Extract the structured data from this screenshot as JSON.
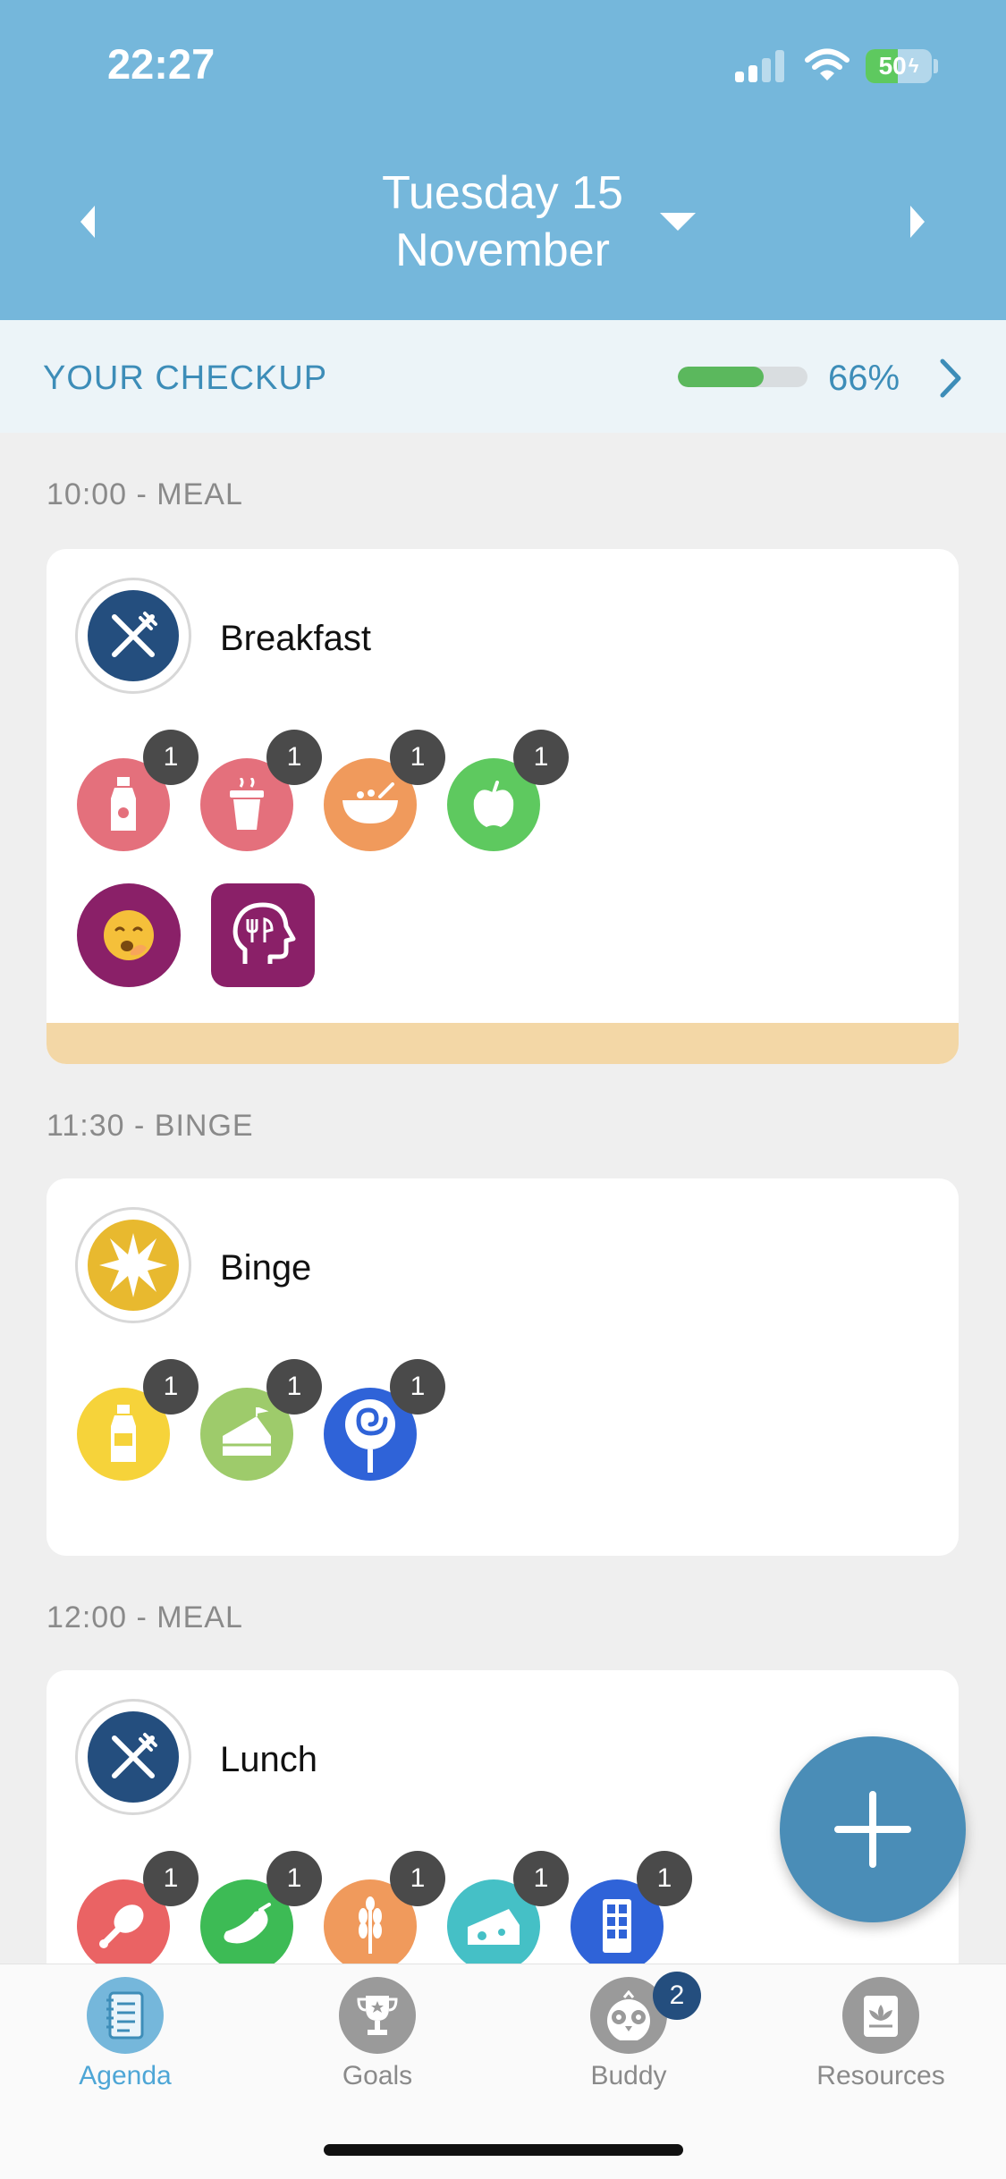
{
  "status_bar": {
    "time": "22:27",
    "battery": "50"
  },
  "header": {
    "date_line1": "Tuesday 15",
    "date_line2": "November"
  },
  "checkup": {
    "title": "YOUR CHECKUP",
    "progress": 0.66,
    "percent_label": "66%"
  },
  "entries": [
    {
      "label": "10:00 - MEAL",
      "title": "Breakfast",
      "avatar_icon": "fork-knife-icon",
      "avatar_color": "#244e7e",
      "items": [
        {
          "icon": "bottle-icon",
          "color": "#e4707c",
          "count": "1"
        },
        {
          "icon": "cup-icon",
          "color": "#e4707c",
          "count": "1"
        },
        {
          "icon": "bowl-icon",
          "color": "#f09a5c",
          "count": "1"
        },
        {
          "icon": "apple-icon",
          "color": "#5ec95f",
          "count": "1"
        }
      ],
      "feelings": [
        {
          "icon": "yawning-face-icon",
          "color": "#8a2068"
        },
        {
          "icon": "head-eating-thought-icon",
          "color": "#8a2068"
        }
      ]
    },
    {
      "label": "11:30 - BINGE",
      "title": "Binge",
      "avatar_icon": "burst-icon",
      "avatar_color": "#e8b92f",
      "items": [
        {
          "icon": "bottle-icon",
          "color": "#f6d33a",
          "count": "1"
        },
        {
          "icon": "cake-slice-icon",
          "color": "#9ecb6b",
          "count": "1"
        },
        {
          "icon": "lollipop-icon",
          "color": "#2f63d8",
          "count": "1"
        }
      ]
    },
    {
      "label": "12:00 - MEAL",
      "title": "Lunch",
      "avatar_icon": "fork-knife-icon",
      "avatar_color": "#244e7e",
      "items": [
        {
          "icon": "drumstick-icon",
          "color": "#ea6364",
          "count": "1"
        },
        {
          "icon": "eggplant-icon",
          "color": "#3dbb55",
          "count": "1"
        },
        {
          "icon": "wheat-icon",
          "color": "#f09a5c",
          "count": "1"
        },
        {
          "icon": "cheese-icon",
          "color": "#45c0c6",
          "count": "1"
        },
        {
          "icon": "chocolate-bar-icon",
          "color": "#2f63d8",
          "count": "1"
        }
      ]
    }
  ],
  "tabs": [
    {
      "label": "Agenda",
      "active": true
    },
    {
      "label": "Goals",
      "active": false
    },
    {
      "label": "Buddy",
      "active": false,
      "badge": "2"
    },
    {
      "label": "Resources",
      "active": false
    }
  ],
  "colors": {
    "header": "#75b7db",
    "accent": "#3d8db8",
    "fab": "#4a8db7",
    "note_bar": "#f3d7a6"
  }
}
